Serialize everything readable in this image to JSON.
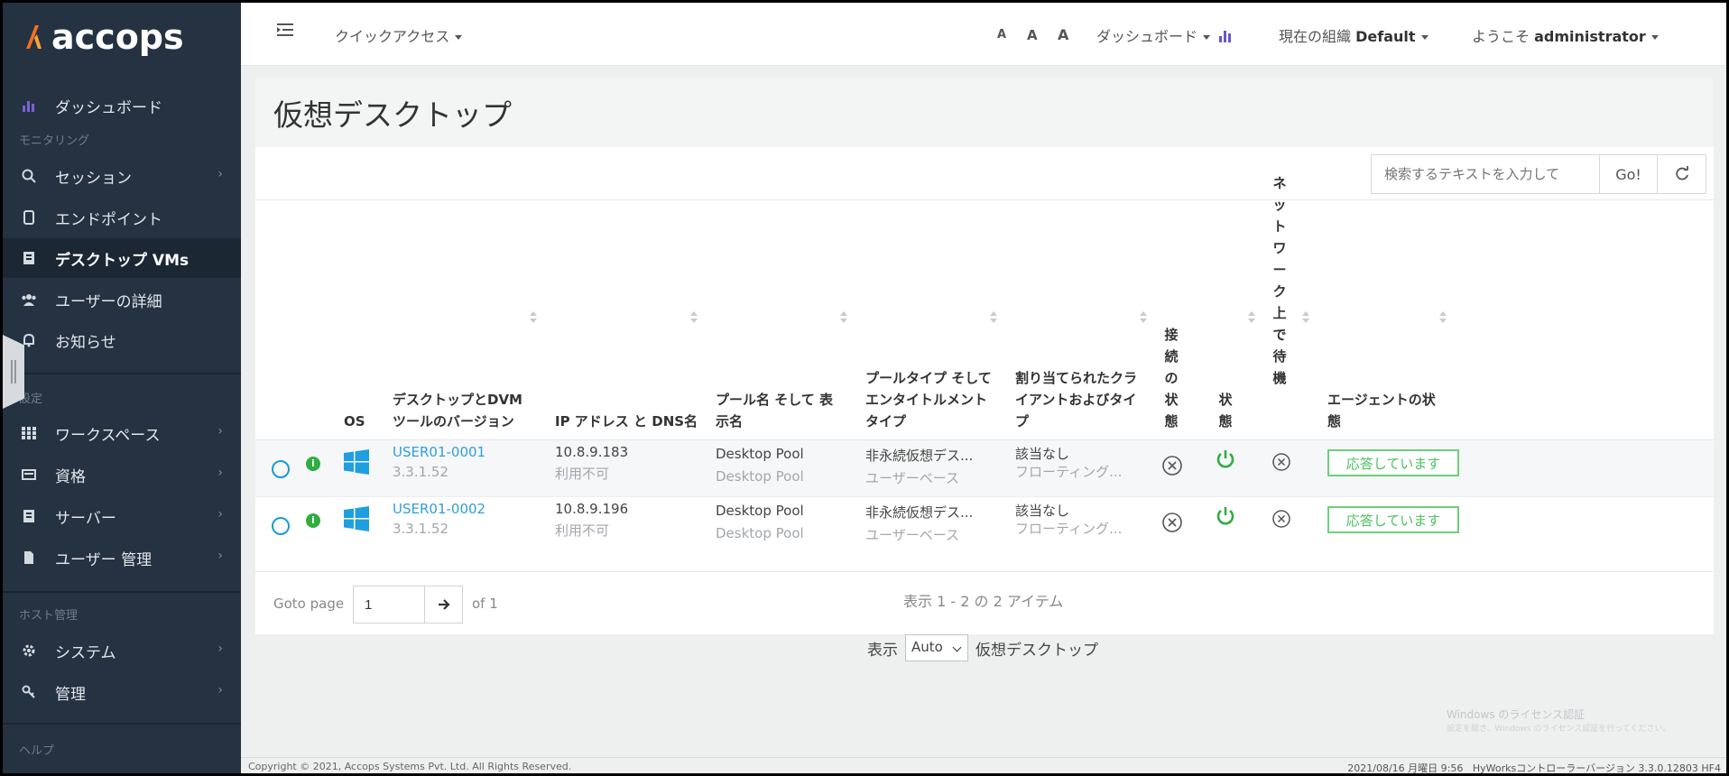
{
  "brand": {
    "name": "accops",
    "accent": "#f36f21"
  },
  "sidebar": {
    "items": [
      {
        "label": "ダッシュボード",
        "icon": "bar-chart-icon"
      },
      {
        "label": "セッション",
        "icon": "search-icon"
      },
      {
        "label": "エンドポイント",
        "icon": "device-icon"
      },
      {
        "label": "デスクトップ VMs",
        "icon": "desktop-icon"
      },
      {
        "label": "ユーザーの詳細",
        "icon": "users-icon"
      },
      {
        "label": "お知らせ",
        "icon": "bell-icon"
      },
      {
        "label": "ワークスペース",
        "icon": "grid-icon"
      },
      {
        "label": "資格",
        "icon": "credentials-icon"
      },
      {
        "label": "サーバー",
        "icon": "server-icon"
      },
      {
        "label": "ユーザー 管理",
        "icon": "file-icon"
      },
      {
        "label": "システム",
        "icon": "gear-icon"
      },
      {
        "label": "管理",
        "icon": "key-icon"
      }
    ],
    "sections": {
      "monitoring": "モニタリング",
      "settings": "設定",
      "host": "ホスト管理",
      "help": "ヘルプ"
    }
  },
  "header": {
    "quick_access": "クイックアクセス",
    "font_sizes": [
      "A",
      "A",
      "A"
    ],
    "dashboard": "ダッシュボード",
    "org_label": "現在の組織",
    "org_value": "Default",
    "welcome_label": "ようこそ",
    "user": "administrator"
  },
  "main": {
    "title": "仮想デスクトップ",
    "search_placeholder": "検索するテキストを入力して",
    "go_label": "Go!",
    "columns": {
      "os": "OS",
      "desktop_line1": "デスクトップとDVM",
      "desktop_line2": "ツールのバージョン",
      "ip": "IP アドレス と DNS名",
      "pool_line1": "プール名 そして 表",
      "pool_line2": "示名",
      "type_line1": "プールタイプ そして",
      "type_line2": "エンタイトルメント",
      "type_line3": "タイプ",
      "client_line1": "割り当てられたクラ",
      "client_line2": "イアントおよびタイ",
      "client_line3": "プ",
      "connection": "接続の状態",
      "state": "状態",
      "network_wait": "ネットワーク上で待機",
      "agent_line1": "エージェントの状",
      "agent_line2": "態"
    },
    "rows": [
      {
        "name": "USER01-0001",
        "version": "3.3.1.52",
        "ip": "10.8.9.183",
        "dns": "利用不可",
        "pool": "Desktop Pool",
        "pool_display": "Desktop Pool",
        "pool_type": "非永続仮想デス...",
        "entitlement": "ユーザーベース",
        "client": "該当なし",
        "client_type": "フローティング...",
        "agent_status": "応答しています"
      },
      {
        "name": "USER01-0002",
        "version": "3.3.1.52",
        "ip": "10.8.9.196",
        "dns": "利用不可",
        "pool": "Desktop Pool",
        "pool_display": "Desktop Pool",
        "pool_type": "非永続仮想デス...",
        "entitlement": "ユーザーベース",
        "client": "該当なし",
        "client_type": "フローティング...",
        "agent_status": "応答しています"
      }
    ],
    "pagination": {
      "goto_label": "Goto page",
      "page": "1",
      "of_label": "of 1",
      "items_label": "表示 1 - 2 の 2 アイテム"
    },
    "show": {
      "label": "表示",
      "value": "Auto",
      "suffix": "仮想デスクトップ"
    }
  },
  "watermark": {
    "line1": "Windows のライセンス認証",
    "line2": "設定を開き、Windows のライセンス認証を行ってください。"
  },
  "footer": {
    "copyright": "Copyright © 2021, Accops Systems Pvt. Ltd. All Rights Reserved.",
    "date": "2021/08/16 月曜日 9:56",
    "version": "HyWorksコントローラーバージョン 3.3.0.12803 HF4"
  }
}
